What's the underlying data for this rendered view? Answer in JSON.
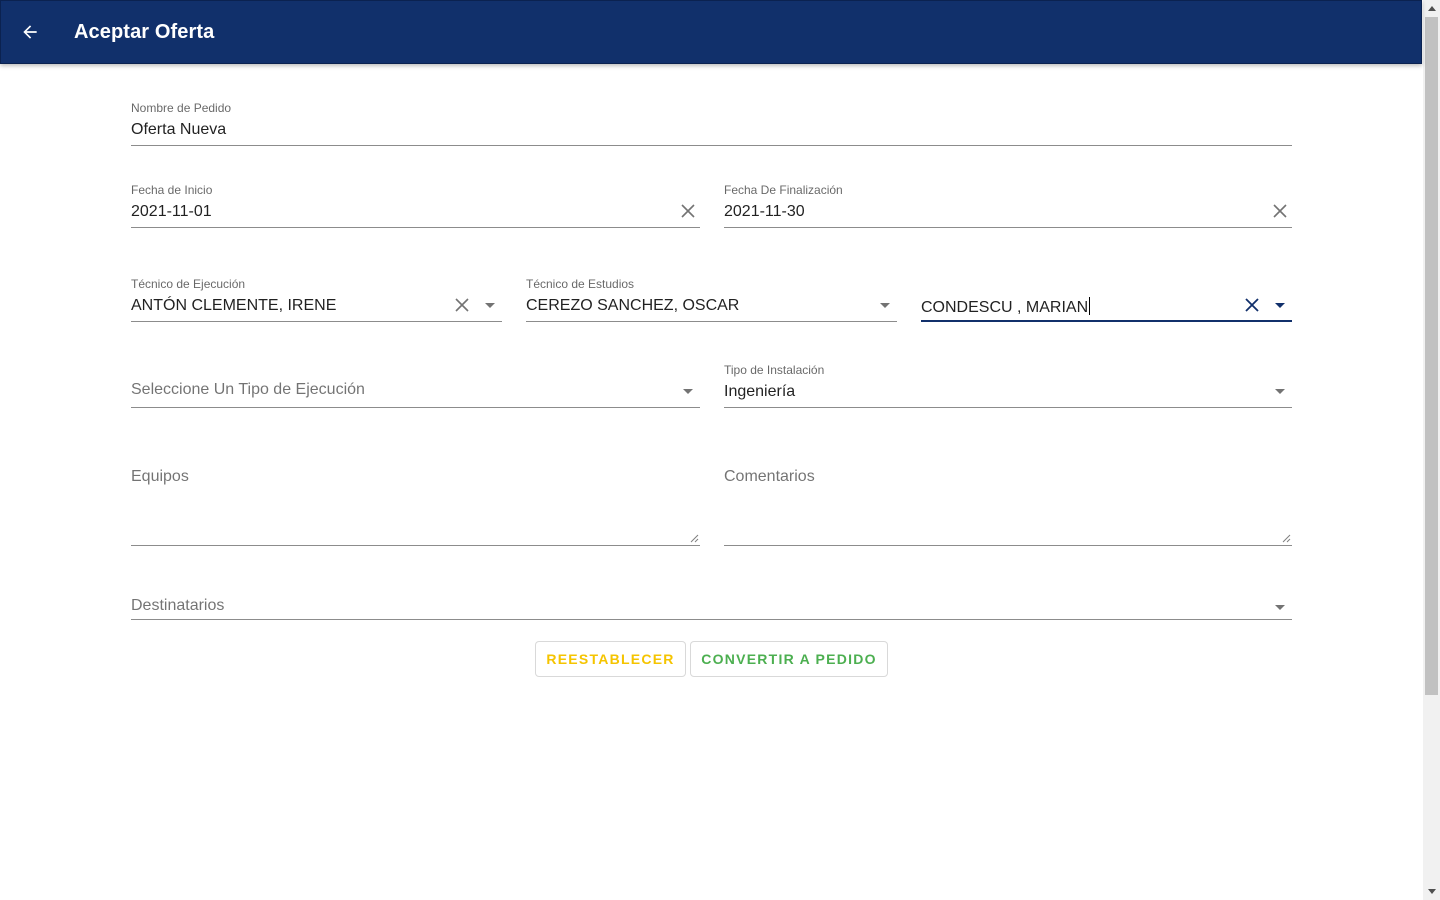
{
  "appbar": {
    "title": "Aceptar Oferta",
    "back_icon": "arrow-back-icon",
    "background": "#11306b"
  },
  "form": {
    "nombre_pedido": {
      "label": "Nombre de Pedido",
      "value": "Oferta Nueva"
    },
    "fecha_inicio": {
      "label": "Fecha de Inicio",
      "value": "2021-11-01"
    },
    "fecha_finalizacion": {
      "label": "Fecha De Finalización",
      "value": "2021-11-30"
    },
    "tecnico_ejecucion": {
      "label": "Técnico de Ejecución",
      "value": "ANTÓN CLEMENTE, IRENE"
    },
    "tecnico_estudios": {
      "label": "Técnico de Estudios",
      "value": "CEREZO SANCHEZ, OSCAR"
    },
    "tecnico_tercero": {
      "value": "CONDESCU , MARIAN"
    },
    "tipo_ejecucion": {
      "placeholder": "Seleccione Un Tipo de Ejecución"
    },
    "tipo_instalacion": {
      "label": "Tipo de Instalación",
      "value": "Ingeniería"
    },
    "equipos": {
      "placeholder": "Equipos"
    },
    "comentarios": {
      "placeholder": "Comentarios"
    },
    "destinatarios": {
      "placeholder": "Destinatarios"
    }
  },
  "actions": {
    "reset_label": "REESTABLECER",
    "reset_color": "#f5c400",
    "convert_label": "CONVERTIR A PEDIDO",
    "convert_color": "#4caf50"
  }
}
